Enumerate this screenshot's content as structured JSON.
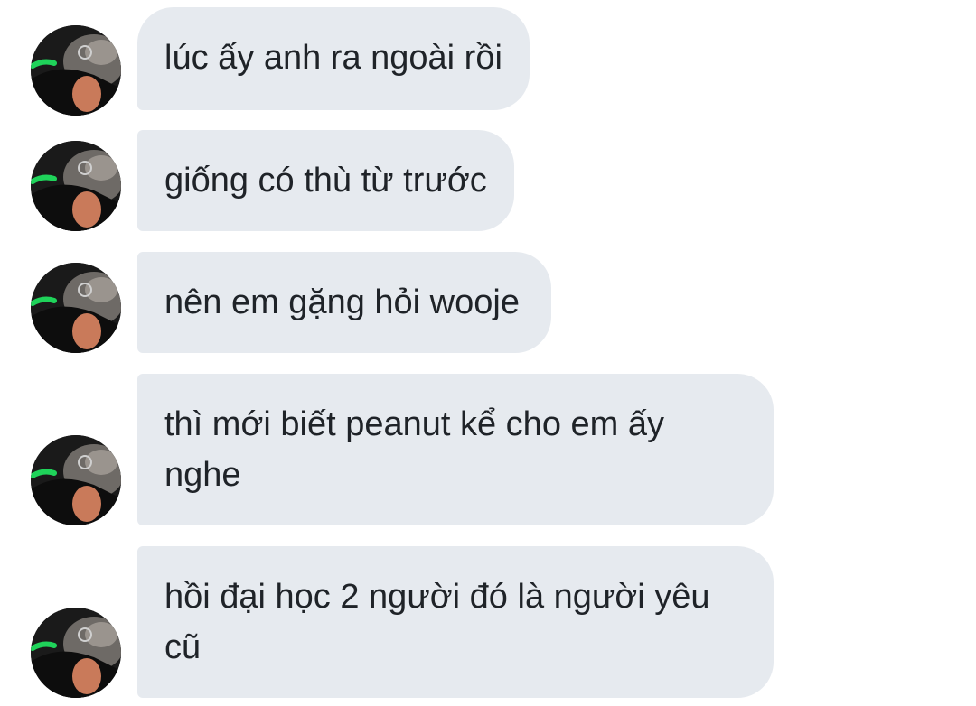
{
  "conversation": {
    "messages": [
      {
        "text": "lúc ấy anh ra ngoài rồi"
      },
      {
        "text": "giống có thù từ trước"
      },
      {
        "text": "nên em gặng hỏi wooje"
      },
      {
        "text": "thì mới biết peanut kể cho em ấy nghe"
      },
      {
        "text": "hồi đại học 2 người đó là người yêu cũ"
      }
    ]
  },
  "colors": {
    "bubble_bg": "#e6eaef",
    "text": "#1f2328",
    "page_bg": "#ffffff"
  }
}
